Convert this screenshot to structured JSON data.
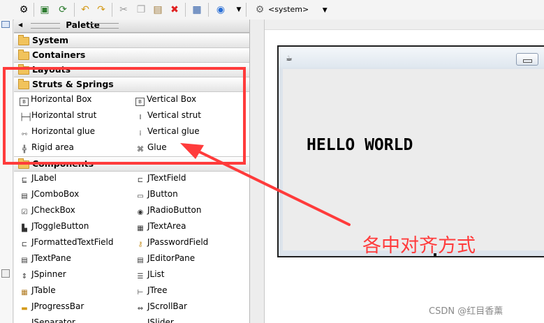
{
  "toolbar": {
    "icons": [
      "sdk-icon",
      "save-icon",
      "refresh-icon",
      "undo-icon",
      "redo-icon",
      "cut-icon",
      "copy-icon",
      "paste-icon",
      "delete-icon",
      "properties-icon",
      "globe-icon",
      "dropdown-icon",
      "system-icon"
    ],
    "laf_label": "<system>"
  },
  "palette": {
    "title": "Palette",
    "categories": {
      "system": "System",
      "containers": "Containers",
      "layouts": "Layouts",
      "struts": "Struts & Springs",
      "components": "Components"
    },
    "struts_items": [
      {
        "label": "Horizontal Box",
        "icon": "horizontal-box-icon"
      },
      {
        "label": "Vertical Box",
        "icon": "vertical-box-icon"
      },
      {
        "label": "Horizontal strut",
        "icon": "horizontal-strut-icon"
      },
      {
        "label": "Vertical strut",
        "icon": "vertical-strut-icon"
      },
      {
        "label": "Horizontal glue",
        "icon": "horizontal-glue-icon"
      },
      {
        "label": "Vertical glue",
        "icon": "vertical-glue-icon"
      },
      {
        "label": "Rigid area",
        "icon": "rigid-area-icon"
      },
      {
        "label": "Glue",
        "icon": "glue-icon"
      }
    ],
    "component_items": [
      {
        "label": "JLabel",
        "icon": "jlabel-icon"
      },
      {
        "label": "JTextField",
        "icon": "jtextfield-icon"
      },
      {
        "label": "JComboBox",
        "icon": "jcombobox-icon"
      },
      {
        "label": "JButton",
        "icon": "jbutton-icon"
      },
      {
        "label": "JCheckBox",
        "icon": "jcheckbox-icon"
      },
      {
        "label": "JRadioButton",
        "icon": "jradiobutton-icon"
      },
      {
        "label": "JToggleButton",
        "icon": "jtogglebutton-icon"
      },
      {
        "label": "JTextArea",
        "icon": "jtextarea-icon"
      },
      {
        "label": "JFormattedTextField",
        "icon": "jformattedtextfield-icon"
      },
      {
        "label": "JPasswordField",
        "icon": "jpasswordfield-icon"
      },
      {
        "label": "JTextPane",
        "icon": "jtextpane-icon"
      },
      {
        "label": "JEditorPane",
        "icon": "jeditorpane-icon"
      },
      {
        "label": "JSpinner",
        "icon": "jspinner-icon"
      },
      {
        "label": "JList",
        "icon": "jlist-icon"
      },
      {
        "label": "JTable",
        "icon": "jtable-icon"
      },
      {
        "label": "JTree",
        "icon": "jtree-icon"
      },
      {
        "label": "JProgressBar",
        "icon": "jprogressbar-icon"
      },
      {
        "label": "JScrollBar",
        "icon": "jscrollbar-icon"
      },
      {
        "label": "JSeparator",
        "icon": "jseparator-icon"
      },
      {
        "label": "JSlider",
        "icon": "jslider-icon"
      }
    ]
  },
  "design": {
    "hello_text": "HELLO WORLD"
  },
  "annotation": {
    "text": "各中对齐方式",
    "color": "#ff3b3b"
  },
  "watermark": "CSDN @红目香薰"
}
